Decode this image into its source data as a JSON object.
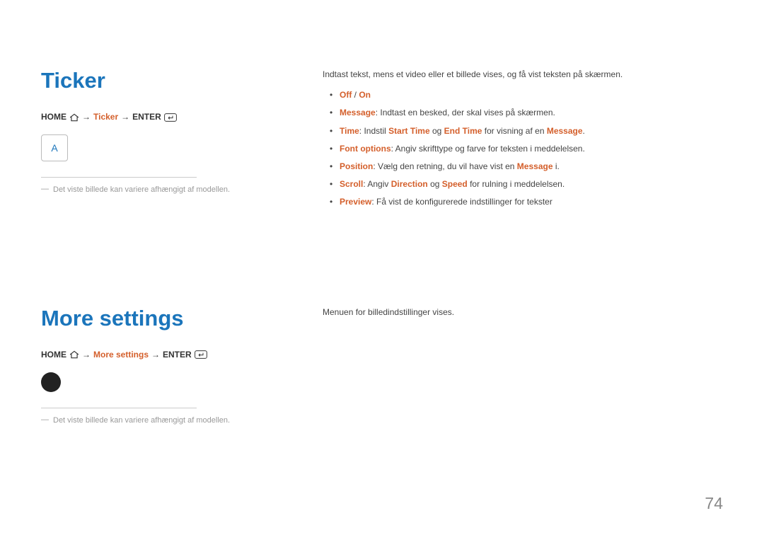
{
  "ticker": {
    "heading": "Ticker",
    "breadcrumb": {
      "home": "HOME",
      "arrow1": "→",
      "item": "Ticker",
      "arrow2": "→",
      "enter": "ENTER"
    },
    "tile_letter": "A",
    "note": "Det viste billede kan variere afhængigt af modellen.",
    "intro": "Indtast tekst, mens et video eller et billede vises, og få vist teksten på skærmen.",
    "items": {
      "off": "Off",
      "slash": " / ",
      "on": "On",
      "message_label": "Message",
      "message_text": ": Indtast en besked, der skal vises på skærmen.",
      "time_label": "Time",
      "time_pre": ": Indstil ",
      "start_time": "Start Time",
      "time_mid": " og ",
      "end_time": "End Time",
      "time_post1": " for visning af en ",
      "time_msg": "Message",
      "time_end": ".",
      "font_label": "Font options",
      "font_text": ": Angiv skrifttype og farve for teksten i meddelelsen.",
      "pos_label": "Position",
      "pos_pre": ":  Vælg den retning, du vil have vist en ",
      "pos_msg": "Message",
      "pos_post": " i.",
      "scroll_label": "Scroll",
      "scroll_pre": ": Angiv ",
      "scroll_dir": "Direction",
      "scroll_mid": " og ",
      "scroll_speed": "Speed",
      "scroll_post": " for rulning i meddelelsen.",
      "preview_label": "Preview",
      "preview_text": ": Få vist de konfigurerede indstillinger for tekster"
    }
  },
  "more": {
    "heading": "More settings",
    "breadcrumb": {
      "home": "HOME",
      "arrow1": "→",
      "item": "More settings",
      "arrow2": "→",
      "enter": "ENTER"
    },
    "note": "Det viste billede kan variere afhængigt af modellen.",
    "intro": "Menuen for billedindstillinger vises."
  },
  "page_number": "74",
  "note_dash": "―"
}
